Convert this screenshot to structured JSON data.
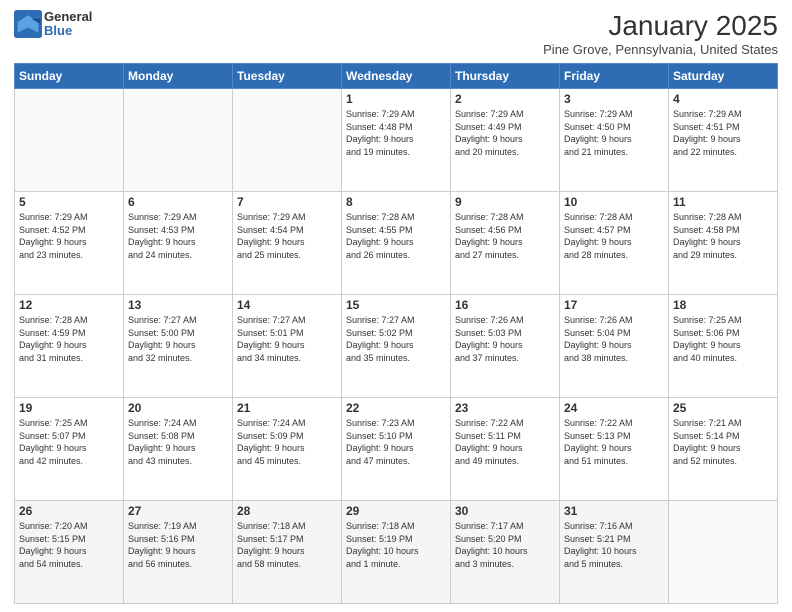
{
  "header": {
    "logo_general": "General",
    "logo_blue": "Blue",
    "month": "January 2025",
    "location": "Pine Grove, Pennsylvania, United States"
  },
  "weekdays": [
    "Sunday",
    "Monday",
    "Tuesday",
    "Wednesday",
    "Thursday",
    "Friday",
    "Saturday"
  ],
  "weeks": [
    [
      {
        "day": "",
        "info": ""
      },
      {
        "day": "",
        "info": ""
      },
      {
        "day": "",
        "info": ""
      },
      {
        "day": "1",
        "info": "Sunrise: 7:29 AM\nSunset: 4:48 PM\nDaylight: 9 hours\nand 19 minutes."
      },
      {
        "day": "2",
        "info": "Sunrise: 7:29 AM\nSunset: 4:49 PM\nDaylight: 9 hours\nand 20 minutes."
      },
      {
        "day": "3",
        "info": "Sunrise: 7:29 AM\nSunset: 4:50 PM\nDaylight: 9 hours\nand 21 minutes."
      },
      {
        "day": "4",
        "info": "Sunrise: 7:29 AM\nSunset: 4:51 PM\nDaylight: 9 hours\nand 22 minutes."
      }
    ],
    [
      {
        "day": "5",
        "info": "Sunrise: 7:29 AM\nSunset: 4:52 PM\nDaylight: 9 hours\nand 23 minutes."
      },
      {
        "day": "6",
        "info": "Sunrise: 7:29 AM\nSunset: 4:53 PM\nDaylight: 9 hours\nand 24 minutes."
      },
      {
        "day": "7",
        "info": "Sunrise: 7:29 AM\nSunset: 4:54 PM\nDaylight: 9 hours\nand 25 minutes."
      },
      {
        "day": "8",
        "info": "Sunrise: 7:28 AM\nSunset: 4:55 PM\nDaylight: 9 hours\nand 26 minutes."
      },
      {
        "day": "9",
        "info": "Sunrise: 7:28 AM\nSunset: 4:56 PM\nDaylight: 9 hours\nand 27 minutes."
      },
      {
        "day": "10",
        "info": "Sunrise: 7:28 AM\nSunset: 4:57 PM\nDaylight: 9 hours\nand 28 minutes."
      },
      {
        "day": "11",
        "info": "Sunrise: 7:28 AM\nSunset: 4:58 PM\nDaylight: 9 hours\nand 29 minutes."
      }
    ],
    [
      {
        "day": "12",
        "info": "Sunrise: 7:28 AM\nSunset: 4:59 PM\nDaylight: 9 hours\nand 31 minutes."
      },
      {
        "day": "13",
        "info": "Sunrise: 7:27 AM\nSunset: 5:00 PM\nDaylight: 9 hours\nand 32 minutes."
      },
      {
        "day": "14",
        "info": "Sunrise: 7:27 AM\nSunset: 5:01 PM\nDaylight: 9 hours\nand 34 minutes."
      },
      {
        "day": "15",
        "info": "Sunrise: 7:27 AM\nSunset: 5:02 PM\nDaylight: 9 hours\nand 35 minutes."
      },
      {
        "day": "16",
        "info": "Sunrise: 7:26 AM\nSunset: 5:03 PM\nDaylight: 9 hours\nand 37 minutes."
      },
      {
        "day": "17",
        "info": "Sunrise: 7:26 AM\nSunset: 5:04 PM\nDaylight: 9 hours\nand 38 minutes."
      },
      {
        "day": "18",
        "info": "Sunrise: 7:25 AM\nSunset: 5:06 PM\nDaylight: 9 hours\nand 40 minutes."
      }
    ],
    [
      {
        "day": "19",
        "info": "Sunrise: 7:25 AM\nSunset: 5:07 PM\nDaylight: 9 hours\nand 42 minutes."
      },
      {
        "day": "20",
        "info": "Sunrise: 7:24 AM\nSunset: 5:08 PM\nDaylight: 9 hours\nand 43 minutes."
      },
      {
        "day": "21",
        "info": "Sunrise: 7:24 AM\nSunset: 5:09 PM\nDaylight: 9 hours\nand 45 minutes."
      },
      {
        "day": "22",
        "info": "Sunrise: 7:23 AM\nSunset: 5:10 PM\nDaylight: 9 hours\nand 47 minutes."
      },
      {
        "day": "23",
        "info": "Sunrise: 7:22 AM\nSunset: 5:11 PM\nDaylight: 9 hours\nand 49 minutes."
      },
      {
        "day": "24",
        "info": "Sunrise: 7:22 AM\nSunset: 5:13 PM\nDaylight: 9 hours\nand 51 minutes."
      },
      {
        "day": "25",
        "info": "Sunrise: 7:21 AM\nSunset: 5:14 PM\nDaylight: 9 hours\nand 52 minutes."
      }
    ],
    [
      {
        "day": "26",
        "info": "Sunrise: 7:20 AM\nSunset: 5:15 PM\nDaylight: 9 hours\nand 54 minutes."
      },
      {
        "day": "27",
        "info": "Sunrise: 7:19 AM\nSunset: 5:16 PM\nDaylight: 9 hours\nand 56 minutes."
      },
      {
        "day": "28",
        "info": "Sunrise: 7:18 AM\nSunset: 5:17 PM\nDaylight: 9 hours\nand 58 minutes."
      },
      {
        "day": "29",
        "info": "Sunrise: 7:18 AM\nSunset: 5:19 PM\nDaylight: 10 hours\nand 1 minute."
      },
      {
        "day": "30",
        "info": "Sunrise: 7:17 AM\nSunset: 5:20 PM\nDaylight: 10 hours\nand 3 minutes."
      },
      {
        "day": "31",
        "info": "Sunrise: 7:16 AM\nSunset: 5:21 PM\nDaylight: 10 hours\nand 5 minutes."
      },
      {
        "day": "",
        "info": ""
      }
    ]
  ]
}
